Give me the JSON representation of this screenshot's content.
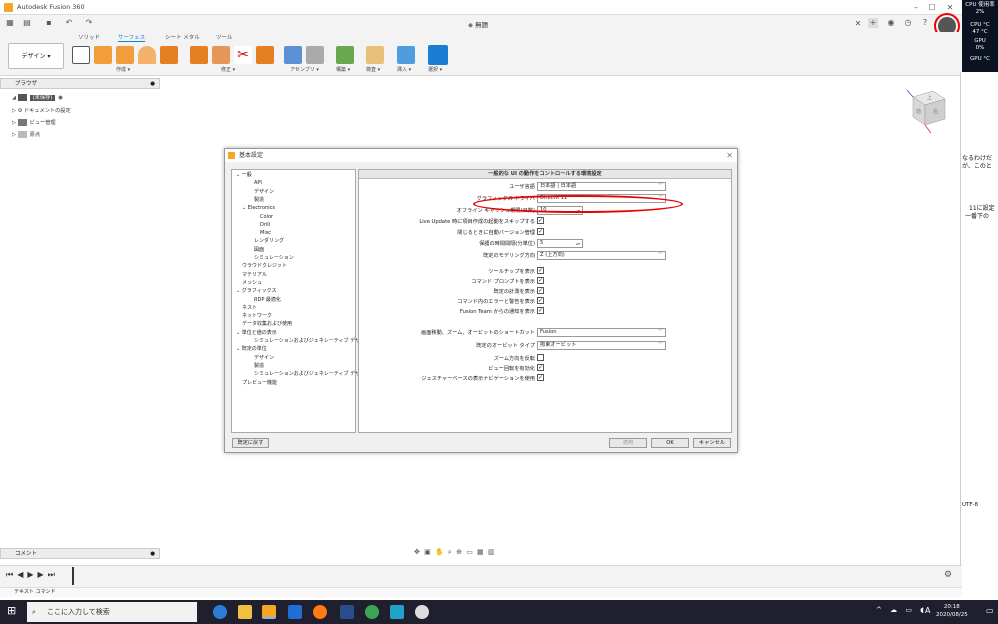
{
  "window": {
    "app_title": "Autodesk Fusion 360",
    "doc_title": "無題"
  },
  "ribbon": {
    "tabs": [
      "ソリッド",
      "サーフェス",
      "シート メタル",
      "ツール"
    ],
    "design_label": "デザイン ▾",
    "groups": [
      "作成 ▾",
      "修正 ▾",
      "アセンブリ ▾",
      "構築 ▾",
      "検査 ▾",
      "挿入 ▾",
      "選択 ▾"
    ]
  },
  "monitor": {
    "cpu_usage_label": "CPU 使用率",
    "cpu_usage": "2%",
    "cpu_temp_label": "CPU °C",
    "cpu_temp": "47 °C",
    "gpu_label": "GPU",
    "gpu_usage": "0%",
    "gpu_temp_label": "GPU °C"
  },
  "browser": {
    "header": "ブラウザ",
    "root": "(未保存)",
    "items": [
      "ドキュメントの設定",
      "ビュー管理",
      "原点"
    ]
  },
  "viewcube": {
    "top": "上",
    "front": "前",
    "right": "右"
  },
  "dialog": {
    "title": "基本設定",
    "panel_header": "一般的な UI の動作をコントロールする環境設定",
    "tree": [
      {
        "label": "一般",
        "indent": 0,
        "expander": "v"
      },
      {
        "label": "API",
        "indent": 2
      },
      {
        "label": "デザイン",
        "indent": 2
      },
      {
        "label": "製造",
        "indent": 2
      },
      {
        "label": "Electronics",
        "indent": 1,
        "expander": "v"
      },
      {
        "label": "Color",
        "indent": 3
      },
      {
        "label": "Drill",
        "indent": 3
      },
      {
        "label": "Misc",
        "indent": 3
      },
      {
        "label": "レンダリング",
        "indent": 2
      },
      {
        "label": "図面",
        "indent": 2
      },
      {
        "label": "シミュレーション",
        "indent": 2
      },
      {
        "label": "ウラウドクレジット",
        "indent": 0
      },
      {
        "label": "マテリアル",
        "indent": 0
      },
      {
        "label": "メッシュ",
        "indent": 0
      },
      {
        "label": "グラフィックス",
        "indent": 0,
        "expander": "v"
      },
      {
        "label": "RDP 最適化",
        "indent": 2
      },
      {
        "label": "ネスト",
        "indent": 0
      },
      {
        "label": "ネットワーク",
        "indent": 0
      },
      {
        "label": "データ収集および使用",
        "indent": 0
      },
      {
        "label": "単位と値の表示",
        "indent": 0,
        "expander": "v"
      },
      {
        "label": "シミュレーションおよびジェネレーティブ デザイン",
        "indent": 2
      },
      {
        "label": "既定の単位",
        "indent": 0,
        "expander": "v"
      },
      {
        "label": "デザイン",
        "indent": 2
      },
      {
        "label": "製造",
        "indent": 2
      },
      {
        "label": "シミュレーションおよびジェネレーティブ デザイン",
        "indent": 2
      },
      {
        "label": "プレビュー機能",
        "indent": 0
      }
    ],
    "settings": {
      "lang_label": "ユーザ言語",
      "lang_value": "日本語 | 日本語",
      "gfx_label": "グラフィックス ドライバ",
      "gfx_value": "DirectX 11",
      "offline_label": "オフライン キャッシュ期限(日数)",
      "offline_value": "10",
      "liveupdate_label": "Live Update 時に項目作成の起動をスキップする",
      "autoversion_label": "閉じるときに自動バージョン管理",
      "interval_label": "保護の時間間隔(分単位)",
      "interval_value": "5",
      "modeling_label": "既定のモデリング方向",
      "modeling_value": "Z (上方向)",
      "tooltips_label": "ツールチップを表示",
      "cmdprompt_label": "コマンド プロンプトを表示",
      "measure_label": "既定の計測を表示",
      "cmderr_label": "コマンド内のエラーと警告を表示",
      "fteam_label": "Fusion Team からの通知を表示",
      "shortcut_label": "画面移動、ズーム、オービットのショートカット",
      "shortcut_value": "Fusion",
      "orbit_label": "既定のオービット タイプ",
      "orbit_value": "拘束オービット",
      "zoomrev_label": "ズーム方向を反転",
      "viewrot_label": "ビュー回転を有効化",
      "gesture_label": "ジェスチャーベースの表示ナビゲーションを使用"
    },
    "reset_label": "既定に戻す",
    "apply_label": "適用",
    "ok_label": "OK",
    "cancel_label": "キャンセル"
  },
  "bottom": {
    "comment_label": "コメント",
    "text_command_label": "テキスト コマンド",
    "encoding": "UTF-8"
  },
  "right_text": {
    "line1": "なるわけだ",
    "line2": "が、このと",
    "line3": "11に設定",
    "line4": "一番下の"
  },
  "taskbar": {
    "search_placeholder": "ここに入力して検索",
    "time": "20:18",
    "date": "2020/08/25",
    "ime": "A"
  },
  "colors": {
    "accent": "#1a7fd4",
    "annotation": "#e00000",
    "taskbar": "#1f1f2e"
  }
}
